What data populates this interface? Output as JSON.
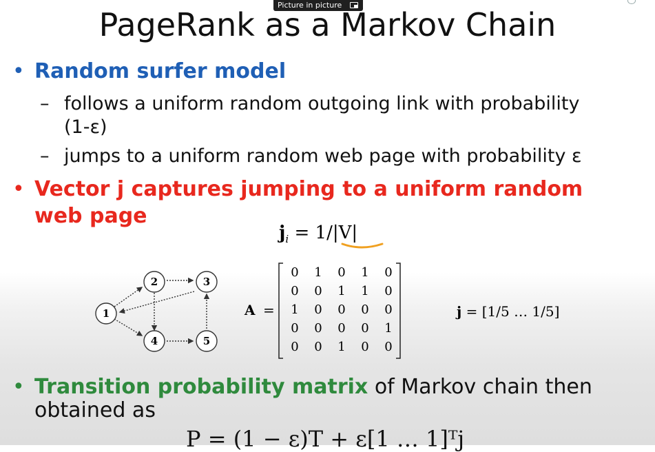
{
  "overlay": {
    "pip_label": "Picture in picture"
  },
  "slide": {
    "title": "PageRank as a Markov Chain",
    "bullet_marker": "•",
    "dash": "–",
    "bullet1": "Random surfer model",
    "sub1_line1": "follows a uniform random outgoing link with probability",
    "sub1_line2": "(1-ε)",
    "sub2": "jumps to a uniform random web page with probability ε",
    "bullet2_line1": "Vector j captures jumping to a uniform random",
    "bullet2_line2": "web page",
    "eq_j_lhs": "j",
    "eq_j_sub": "i",
    "eq_j_rhs": " = 1/|V|",
    "graph_nodes": [
      "1",
      "2",
      "3",
      "4",
      "5"
    ],
    "A_label": "A",
    "A_eq": "=",
    "matrix_rows": [
      [
        "0",
        "1",
        "0",
        "1",
        "0"
      ],
      [
        "0",
        "0",
        "1",
        "1",
        "0"
      ],
      [
        "1",
        "0",
        "0",
        "0",
        "0"
      ],
      [
        "0",
        "0",
        "0",
        "0",
        "1"
      ],
      [
        "0",
        "0",
        "1",
        "0",
        "0"
      ]
    ],
    "jvec_label": "j",
    "jvec_value": " = [1/5   …   1/5]",
    "bullet3_green": "Transition probability matrix",
    "bullet3_rest": " of Markov chain then",
    "bullet3_line2": "obtained as",
    "p_eq": "P = (1 − ε)T + ε[1 … 1]ᵀj"
  },
  "colors": {
    "blue": "#1f5fb5",
    "red": "#e8281e",
    "green": "#2f8a3d",
    "underline": "#f0a020"
  }
}
